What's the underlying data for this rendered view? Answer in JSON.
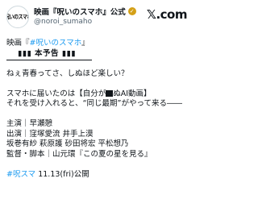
{
  "account": {
    "display_name": "映画『呪いのスマホ』公式",
    "handle": "@noroi_sumaho",
    "avatar_text": "呪いのスマホ",
    "verified_color": "#d4a017"
  },
  "brand": {
    "logo_text": "𝕏.com"
  },
  "post": {
    "title_prefix": "映画『",
    "title_link": "#呪いのスマホ",
    "title_suffix": "』",
    "trailer": "▮▮▮ 本予告 ▮▮▮",
    "line1": "ねぇ青春ってさ、しぬほど楽しい？",
    "line2a": "スマホに届いたのは【自分が",
    "line2b": "ぬAI動画】",
    "line3": "それを受け入れると、“同じ最期”がやって来る――",
    "credits": [
      "主演｜早瀬憩",
      "出演｜窪塚愛流 井手上漠",
      "坂巻有紗 萩原護 砂田将宏 平松想乃",
      "監督・脚本｜山元環『この夏の星を見る』"
    ],
    "footer_link": "#呪スマ",
    "footer_text": " 11.13(fri)公開"
  }
}
